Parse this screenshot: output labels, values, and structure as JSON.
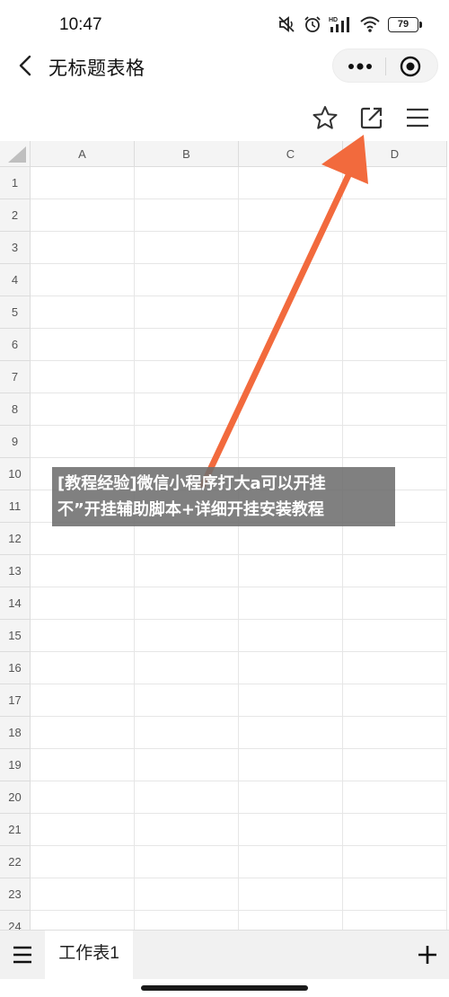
{
  "status_bar": {
    "time": "10:47",
    "battery": "79",
    "network_label": "HD"
  },
  "header": {
    "title": "无标题表格"
  },
  "toolbar": {
    "icons": [
      "star-icon",
      "share-icon",
      "menu-icon"
    ]
  },
  "spreadsheet": {
    "columns": [
      "A",
      "B",
      "C",
      "D"
    ],
    "rows": [
      "1",
      "2",
      "3",
      "4",
      "5",
      "6",
      "7",
      "8",
      "9",
      "10",
      "11",
      "12",
      "13",
      "14",
      "15",
      "16",
      "17",
      "18",
      "19",
      "20",
      "21",
      "22",
      "23",
      "24"
    ]
  },
  "caption": {
    "line1": "[教程经验]微信小程序打大a可以开挂",
    "line2": "不”开挂辅助脚本+详细开挂安装教程"
  },
  "bottom_bar": {
    "sheet_tab": "工作表1"
  },
  "colors": {
    "arrow": "#f26a3d",
    "grid_header": "#f4f4f4",
    "caption_bg": "#6e6e6e"
  }
}
